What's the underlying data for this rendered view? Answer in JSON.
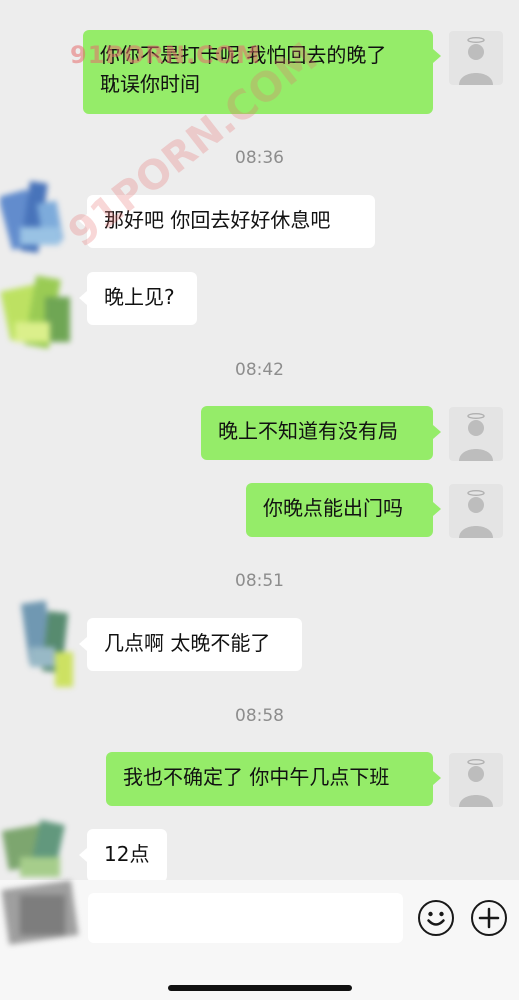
{
  "messages": [
    {
      "dir": "out",
      "text": "你你不是打卡呢 我怕回去的晚了\n耽误你时间"
    },
    {
      "time": "08:36"
    },
    {
      "dir": "in",
      "text": "那好吧 你回去好好休息吧"
    },
    {
      "dir": "in",
      "text": "晚上见?"
    },
    {
      "time": "08:42"
    },
    {
      "dir": "out",
      "text": "晚上不知道有没有局"
    },
    {
      "dir": "out",
      "text": "你晚点能出门吗"
    },
    {
      "time": "08:51"
    },
    {
      "dir": "in",
      "text": "几点啊 太晚不能了"
    },
    {
      "time": "08:58"
    },
    {
      "dir": "out",
      "text": "我也不确定了 你中午几点下班"
    },
    {
      "dir": "in",
      "text": "12点"
    }
  ],
  "watermark": {
    "top_text": "91PORN.COM",
    "diagonal_text": "91PORN.COM",
    "color": "#e66e6e"
  },
  "input_bar": {
    "emoji_icon": "smiley-icon",
    "plus_icon": "plus-circle-icon"
  },
  "colors": {
    "outgoing_bubble": "#95ec69",
    "incoming_bubble": "#ffffff",
    "background": "#ededed"
  }
}
